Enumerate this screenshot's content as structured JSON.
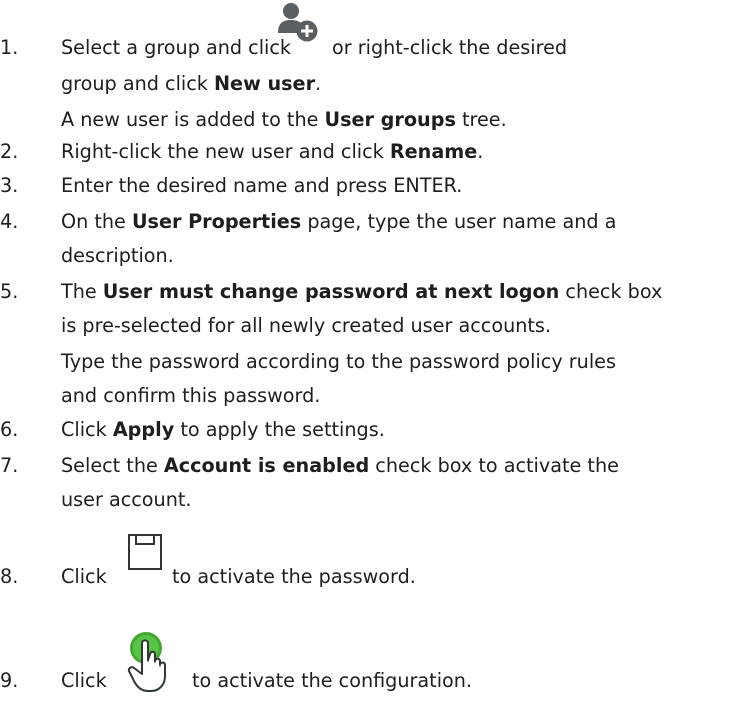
{
  "steps": [
    {
      "number": "1.",
      "l1a": "Select a group and click",
      "l1b": "or right-click the desired",
      "l2a": "group and click ",
      "l2b": "New user",
      "l2c": ".",
      "l3a": "A new user is added to the ",
      "l3b": "User groups",
      "l3c": " tree."
    },
    {
      "number": "2.",
      "a": "Right-click the new user and click ",
      "b": "Rename",
      "c": "."
    },
    {
      "number": "3.",
      "a": "Enter the desired name and press ENTER."
    },
    {
      "number": "4.",
      "l1a": "On the ",
      "l1b": "User Properties",
      "l1c": " page, type the user name and a",
      "l2": "description."
    },
    {
      "number": "5.",
      "l1a": "The ",
      "l1b": "User must change password at next logon",
      "l1c": " check box",
      "l2": "is pre-selected for all newly created user accounts.",
      "l3": "Type the password according to the password policy rules",
      "l4": "and confirm this password."
    },
    {
      "number": "6.",
      "a": "Click ",
      "b": "Apply",
      "c": " to apply the settings."
    },
    {
      "number": "7.",
      "l1a": "Select the ",
      "l1b": "Account is enabled",
      "l1c": " check box to activate the",
      "l2": "user account."
    },
    {
      "number": "8.",
      "a": "Click",
      "c": "to activate the password."
    },
    {
      "number": "9.",
      "a": "Click",
      "c": "to activate the configuration."
    }
  ],
  "icons": {
    "new_user": "add-user-icon",
    "save": "save-icon",
    "activate": "activate-hand-icon"
  }
}
